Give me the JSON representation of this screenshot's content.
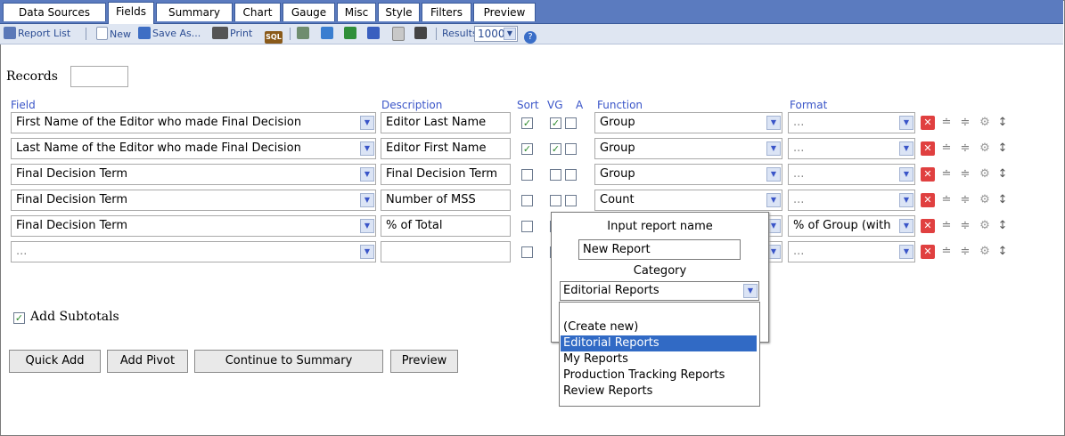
{
  "tabs": [
    "Data Sources",
    "Fields",
    "Summary",
    "Chart",
    "Gauge",
    "Misc",
    "Style",
    "Filters",
    "Preview"
  ],
  "active_tab": "Fields",
  "toolbar": {
    "report_list": "Report List",
    "new": "New",
    "save_as": "Save As...",
    "print": "Print",
    "sql": "SQL",
    "results_label": "Results",
    "results_value": "1000"
  },
  "records_label": "Records",
  "headers": {
    "field": "Field",
    "description": "Description",
    "sort": "Sort",
    "vg": "VG",
    "a": "A",
    "function": "Function",
    "format": "Format"
  },
  "rows": [
    {
      "field": "First Name of the Editor who made Final Decision",
      "description": "Editor Last Name",
      "sort": true,
      "vg": true,
      "a": false,
      "function": "Group",
      "format": "..."
    },
    {
      "field": "Last Name of the Editor who made Final Decision",
      "description": "Editor First Name",
      "sort": true,
      "vg": true,
      "a": false,
      "function": "Group",
      "format": "..."
    },
    {
      "field": "Final Decision Term",
      "description": "Final Decision Term",
      "sort": false,
      "vg": false,
      "a": false,
      "function": "Group",
      "format": "..."
    },
    {
      "field": "Final Decision Term",
      "description": "Number of MSS",
      "sort": false,
      "vg": false,
      "a": false,
      "function": "Count",
      "format": "..."
    },
    {
      "field": "Final Decision Term",
      "description": "% of Total",
      "sort": false,
      "vg": false,
      "a": false,
      "function": "",
      "format": "% of Group (with"
    },
    {
      "field": "...",
      "description": "",
      "sort": false,
      "vg": false,
      "a": false,
      "function": "",
      "format": "..."
    }
  ],
  "add_subtotals": "Add Subtotals",
  "buttons": {
    "quick_add": "Quick Add",
    "add_pivot": "Add Pivot",
    "continue": "Continue to Summary",
    "preview": "Preview"
  },
  "popup": {
    "name_label": "Input report name",
    "name_value": "New Report",
    "category_label": "Category",
    "category_value": "Editorial Reports",
    "options": [
      "(Create new)",
      "Editorial Reports",
      "My Reports",
      "Production Tracking Reports",
      "Review Reports"
    ],
    "selected_option": "Editorial Reports"
  },
  "colors": {
    "tab_bar": "#5b7bbf",
    "toolbar_bg": "#dfe6f2",
    "header_text": "#3a55c8",
    "selection": "#316ac5",
    "delete_red": "#e04040"
  }
}
